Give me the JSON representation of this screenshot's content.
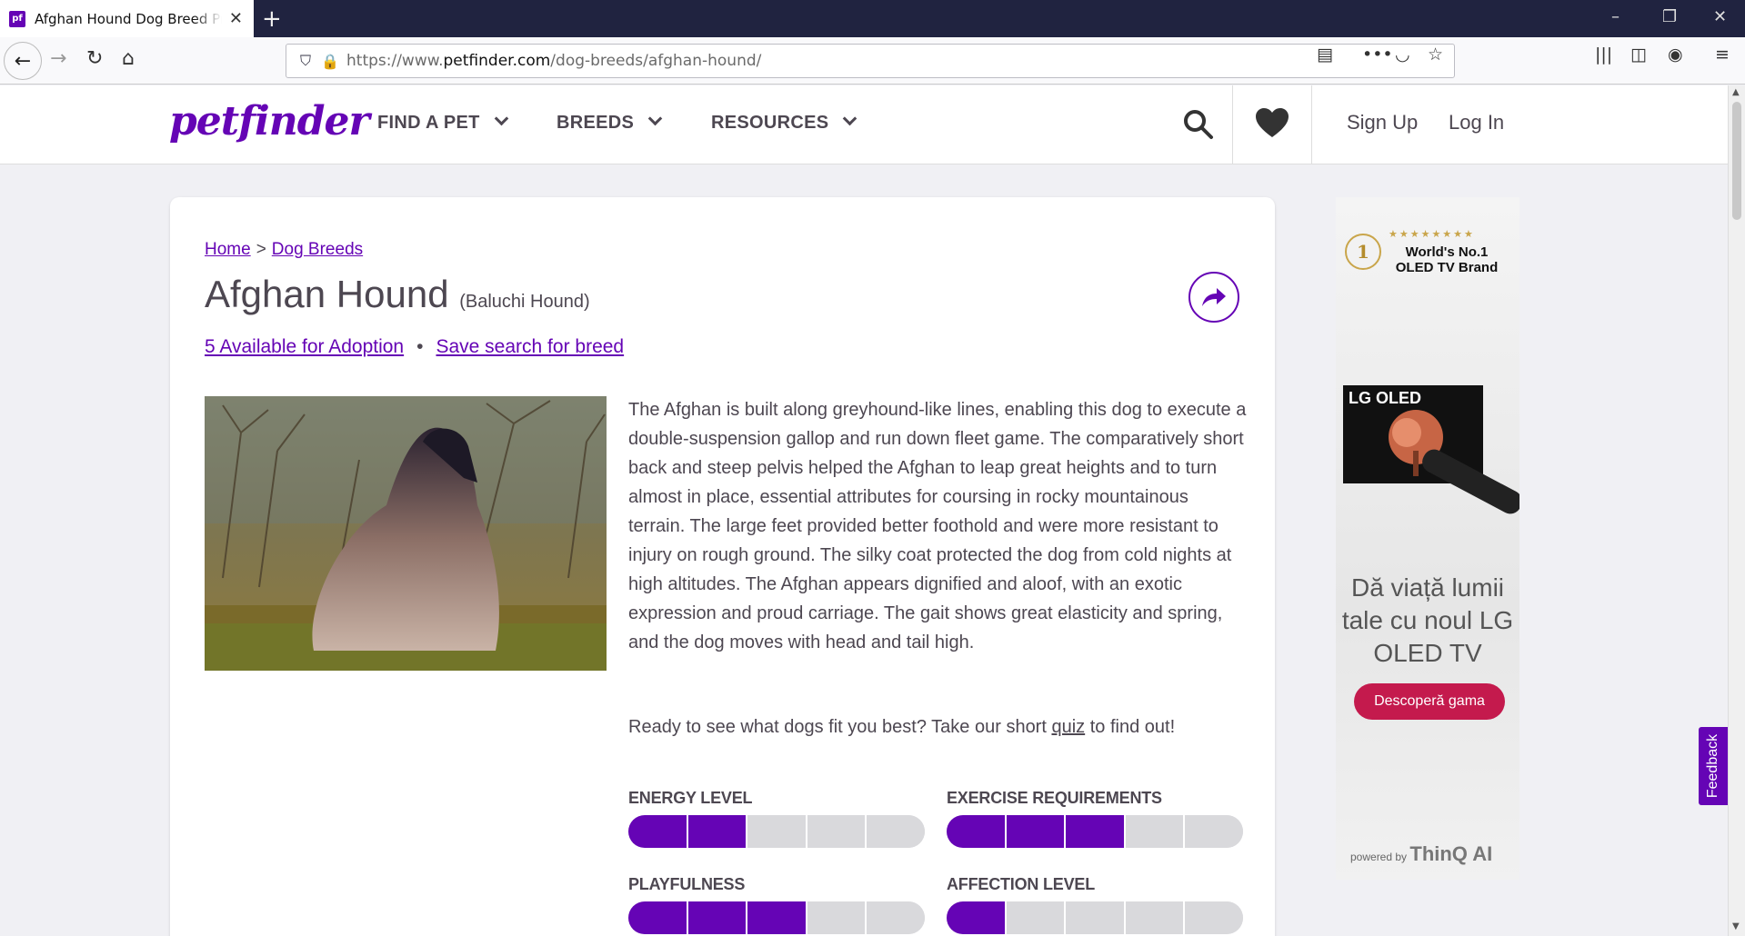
{
  "browser": {
    "tab_title": "Afghan Hound Dog Breed Profile",
    "favicon_text": "pf",
    "url_prefix": "https://www.",
    "url_domain": "petfinder.com",
    "url_path": "/dog-breeds/afghan-hound/"
  },
  "header": {
    "logo": "petfinder",
    "menu": [
      "FIND A PET",
      "BREEDS",
      "RESOURCES"
    ],
    "sign_up": "Sign Up",
    "log_in": "Log In"
  },
  "breadcrumb": {
    "home": "Home",
    "separator": ">",
    "dog_breeds": "Dog Breeds"
  },
  "breed": {
    "name": "Afghan Hound",
    "alt_name": "(Baluchi Hound)",
    "adoption_link": "5 Available for Adoption",
    "save_search": "Save search for breed",
    "description": "The Afghan is built along greyhound-like lines, enabling this dog to execute a double-suspension gallop and run down fleet game. The comparatively short back and steep pelvis helped the Afghan to leap great heights and to turn almost in place, essential attributes for coursing in rocky mountainous terrain. The large feet provided better foothold and were more resistant to injury on rough ground. The silky coat protected the dog from cold nights at high altitudes. The Afghan appears dignified and aloof, with an exotic expression and proud carriage. The gait shows great elasticity and spring, and the dog moves with head and tail high.",
    "quiz_before": "Ready to see what dogs fit you best? Take our short ",
    "quiz_link": "quiz",
    "quiz_after": " to find out!"
  },
  "meters": [
    {
      "label": "ENERGY LEVEL",
      "filled": 2,
      "total": 5
    },
    {
      "label": "EXERCISE REQUIREMENTS",
      "filled": 3,
      "total": 5
    },
    {
      "label": "PLAYFULNESS",
      "filled": 3,
      "total": 5
    },
    {
      "label": "AFFECTION LEVEL",
      "filled": 1,
      "total": 5
    }
  ],
  "ad": {
    "badge": "1",
    "stars": "★★★★★★★★",
    "brand_line1": "World's No.1",
    "brand_line2": "OLED TV Brand",
    "tv_label": "LG OLED",
    "headline": "Dă viață lumii tale cu noul LG OLED TV",
    "cta": "Descoperă gama",
    "powered_prefix": "powered by ",
    "powered_brand": "ThinQ AI"
  },
  "feedback": "Feedback",
  "colors": {
    "brand": "#6504b5",
    "text": "#4d4751",
    "meter_off": "#d9d9dc",
    "ad_cta": "#c41a4d"
  }
}
